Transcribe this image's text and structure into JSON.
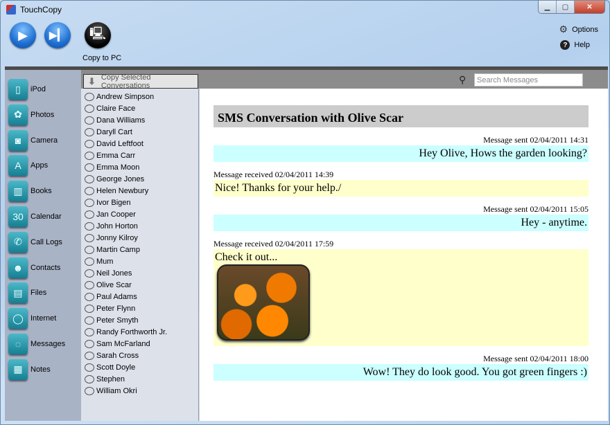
{
  "window": {
    "title": "TouchCopy"
  },
  "toolbar": {
    "play_icon": "play-icon",
    "next_icon": "skip-next-icon",
    "copy_to_pc": "Copy to PC",
    "options": "Options",
    "help": "Help"
  },
  "sidebar": {
    "items": [
      {
        "label": "iPod",
        "icon": "ipod-icon",
        "glyph": "▯"
      },
      {
        "label": "Photos",
        "icon": "photos-icon",
        "glyph": "✿"
      },
      {
        "label": "Camera",
        "icon": "camera-icon",
        "glyph": "◙"
      },
      {
        "label": "Apps",
        "icon": "apps-icon",
        "glyph": "A"
      },
      {
        "label": "Books",
        "icon": "books-icon",
        "glyph": "▥"
      },
      {
        "label": "Calendar",
        "icon": "calendar-icon",
        "glyph": "30"
      },
      {
        "label": "Call Logs",
        "icon": "phone-icon",
        "glyph": "✆"
      },
      {
        "label": "Contacts",
        "icon": "contacts-icon",
        "glyph": "☻"
      },
      {
        "label": "Files",
        "icon": "files-icon",
        "glyph": "▤"
      },
      {
        "label": "Internet",
        "icon": "internet-icon",
        "glyph": "◯"
      },
      {
        "label": "Messages",
        "icon": "messages-icon",
        "glyph": "◌"
      },
      {
        "label": "Notes",
        "icon": "notes-icon",
        "glyph": "▦"
      }
    ]
  },
  "list": {
    "copy_button": "Copy Selected Conversations",
    "search_placeholder": "Search Messages",
    "contacts": [
      "Andrew Simpson",
      "Claire Face",
      "Dana Williams",
      "Daryll Cart",
      "David Leftfoot",
      "Emma Carr",
      "Emma Moon",
      "George Jones",
      "Helen Newbury",
      "Ivor Bigen",
      "Jan Cooper",
      "John Horton",
      "Jonny Kilroy",
      "Martin Camp",
      "Mum",
      "Neil Jones",
      "Olive Scar",
      "Paul Adams",
      "Peter Flynn",
      "Peter Smyth",
      "Randy Forthworth Jr.",
      "Sam McFarland",
      "Sarah Cross",
      "Scott Doyle",
      "Stephen",
      "William Okri"
    ]
  },
  "conversation": {
    "title": "SMS Conversation with Olive Scar",
    "messages": [
      {
        "direction": "sent",
        "meta": "Message sent 02/04/2011 14:31",
        "text": "Hey Olive, Hows the garden looking?"
      },
      {
        "direction": "received",
        "meta": "Message received 02/04/2011 14:39",
        "text": "Nice! Thanks for your help./"
      },
      {
        "direction": "sent",
        "meta": "Message sent 02/04/2011 15:05",
        "text": "Hey - anytime."
      },
      {
        "direction": "received",
        "meta": "Message received 02/04/2011 17:59",
        "text": "Check it out..."
      },
      {
        "direction": "sent",
        "meta": "Message sent 02/04/2011 18:00",
        "text": "Wow! They do look good. You got green fingers :)"
      }
    ]
  },
  "colors": {
    "sent_bg": "#ccffff",
    "received_bg": "#ffffcc",
    "title_bg": "#cccccc"
  }
}
